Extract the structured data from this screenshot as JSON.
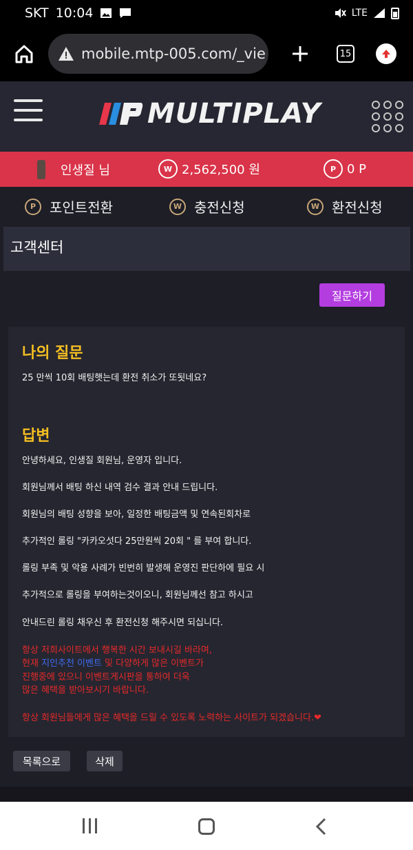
{
  "status_bar": {
    "carrier": "SKT",
    "time": "10:04",
    "network": "LTE"
  },
  "browser": {
    "url": "mobile.mtp-005.com/_vie",
    "tab_count": "15"
  },
  "site": {
    "logo_text": "MULTIPLAY"
  },
  "user_bar": {
    "username": "인생질 님",
    "money_icon": "W",
    "money": "2,562,500 원",
    "point_icon": "P",
    "points": "0 P"
  },
  "menu": {
    "items": [
      {
        "icon": "P",
        "label": "포인트전환"
      },
      {
        "icon": "W",
        "label": "충전신청"
      },
      {
        "icon": "W",
        "label": "환전신청"
      }
    ]
  },
  "page": {
    "title": "고객센터",
    "ask_button": "질문하기"
  },
  "question": {
    "heading": "나의 질문",
    "text": "25 만씩 10회 배팅햇는데 환전 취소가 또됫네요?"
  },
  "answer": {
    "heading": "답변",
    "lines": [
      "안녕하세요, 인생질 회원님, 운영자 입니다.",
      "회원님께서 배팅 하신 내역 검수 결과 안내 드립니다.",
      "회원님의 배팅 성향을 보아, 일정한 배팅금액 및 연속된회차로",
      "추가적인 롤링 \"카카오섯다 25만원씩 20회 \" 를 부여 합니다.",
      "롤링 부족 및 악용 사례가 빈번히 발생해 운영진 판단하에 필요 시",
      "추가적으로 롤링을 부여하는것이오니, 회원님께선 참고 하시고",
      "안내드린 롤링 채우신 후 환전신청 해주시면 되십니다."
    ],
    "notice": {
      "line1": "항상 저희사이트에서 행복한 시간 보내시길 바라며,",
      "line2_a": "현재 ",
      "line2_b": "지인추천 이벤트",
      "line2_c": " 및 다양하게 많은 이벤트가",
      "line3": "진행중에 있으니 이벤트게시판을 통하여 더욱",
      "line4": "많은 혜택을 받아보시기 바랍니다.",
      "line5": "항상 회원님들에게 많은 혜택을 드릴 수 있도록 노력하는 사이트가 되겠습니다.❤"
    }
  },
  "actions": {
    "list_button": "목록으로",
    "delete_button": "삭제"
  }
}
